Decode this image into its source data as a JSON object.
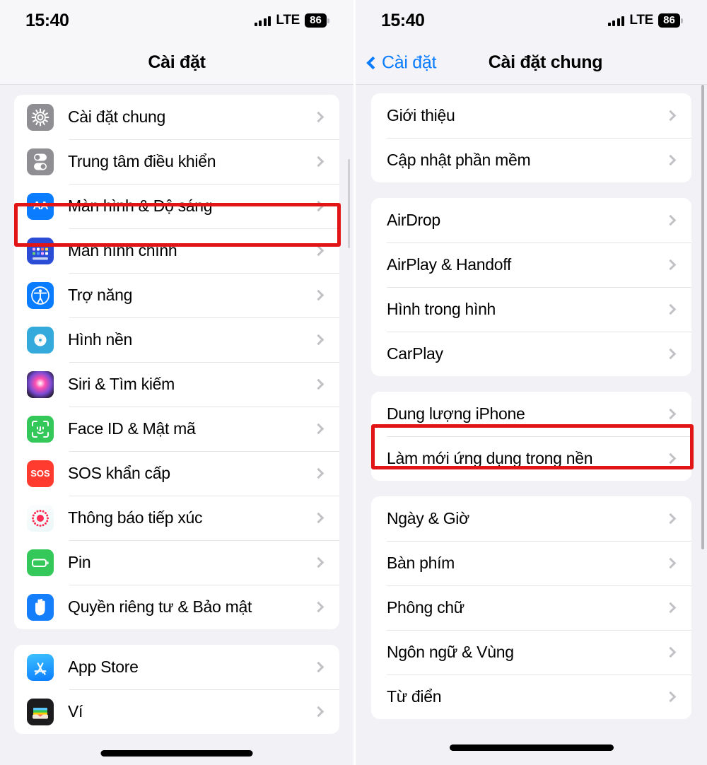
{
  "left_screen": {
    "status": {
      "time": "15:40",
      "network": "LTE",
      "battery": "86"
    },
    "nav": {
      "title": "Cài đặt"
    },
    "groups": [
      {
        "id": "group-main",
        "items": [
          {
            "label": "Cài đặt chung",
            "icon": "gear-icon",
            "highlighted": true
          },
          {
            "label": "Trung tâm điều khiển",
            "icon": "control-center-icon"
          },
          {
            "label": "Màn hình & Độ sáng",
            "icon": "display-brightness-icon"
          },
          {
            "label": "Màn hình chính",
            "icon": "home-screen-icon"
          },
          {
            "label": "Trợ năng",
            "icon": "accessibility-icon"
          },
          {
            "label": "Hình nền",
            "icon": "wallpaper-icon"
          },
          {
            "label": "Siri & Tìm kiếm",
            "icon": "siri-icon"
          },
          {
            "label": "Face ID & Mật mã",
            "icon": "face-id-icon"
          },
          {
            "label": "SOS khẩn cấp",
            "icon": "sos-icon"
          },
          {
            "label": "Thông báo tiếp xúc",
            "icon": "exposure-notification-icon"
          },
          {
            "label": "Pin",
            "icon": "battery-icon"
          },
          {
            "label": "Quyền riêng tư & Bảo mật",
            "icon": "privacy-hand-icon"
          }
        ]
      },
      {
        "id": "group-store",
        "items": [
          {
            "label": "App Store",
            "icon": "app-store-icon"
          },
          {
            "label": "Ví",
            "icon": "wallet-icon"
          }
        ]
      }
    ]
  },
  "right_screen": {
    "status": {
      "time": "15:40",
      "network": "LTE",
      "battery": "86"
    },
    "nav": {
      "back_label": "Cài đặt",
      "title": "Cài đặt chung"
    },
    "groups": [
      {
        "id": "group-about",
        "items": [
          {
            "label": "Giới thiệu"
          },
          {
            "label": "Cập nhật phần mềm"
          }
        ]
      },
      {
        "id": "group-connectivity",
        "items": [
          {
            "label": "AirDrop"
          },
          {
            "label": "AirPlay & Handoff"
          },
          {
            "label": "Hình trong hình"
          },
          {
            "label": "CarPlay"
          }
        ]
      },
      {
        "id": "group-storage",
        "items": [
          {
            "label": "Dung lượng iPhone",
            "highlighted": true
          },
          {
            "label": "Làm mới ứng dụng trong nền"
          }
        ]
      },
      {
        "id": "group-system",
        "items": [
          {
            "label": "Ngày & Giờ"
          },
          {
            "label": "Bàn phím"
          },
          {
            "label": "Phông chữ"
          },
          {
            "label": "Ngôn ngữ & Vùng"
          },
          {
            "label": "Từ điển"
          }
        ]
      }
    ]
  },
  "colors": {
    "accent_blue": "#0a7cff",
    "highlight_red": "#e11515",
    "page_background": "#f2f1f6",
    "card_background": "#ffffff"
  }
}
